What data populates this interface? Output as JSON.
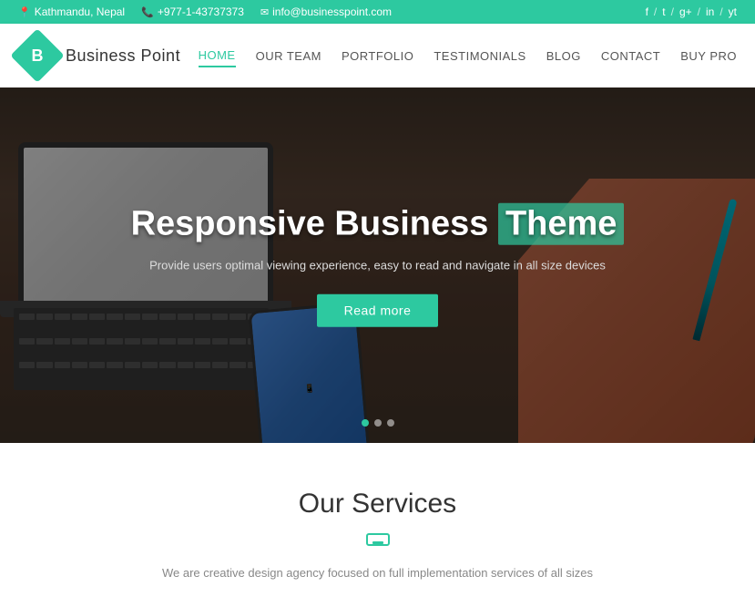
{
  "topbar": {
    "location": "Kathmandu, Nepal",
    "phone": "+977-1-43737373",
    "email": "info@businesspoint.com",
    "social": [
      "f",
      "/",
      "t",
      "/",
      "g+",
      "/",
      "in",
      "/",
      "yt"
    ]
  },
  "header": {
    "logo_letter": "B",
    "logo_text": "Business  Point",
    "nav_items": [
      {
        "label": "HOME",
        "active": true
      },
      {
        "label": "OUR TEAM",
        "active": false
      },
      {
        "label": "PORTFOLIO",
        "active": false
      },
      {
        "label": "TESTIMONIALS",
        "active": false
      },
      {
        "label": "BLOG",
        "active": false
      },
      {
        "label": "CONTACT",
        "active": false
      },
      {
        "label": "BUY PRO",
        "active": false
      }
    ]
  },
  "hero": {
    "title_part1": "Responsive Business ",
    "title_part2": "Theme",
    "subtitle": "Provide users optimal viewing experience, easy to read and navigate in all size devices",
    "cta_label": "Read more",
    "dots": [
      true,
      false,
      false
    ]
  },
  "services": {
    "title": "Our Services",
    "subtitle": "We are creative design agency focused on full implementation services of all sizes"
  }
}
